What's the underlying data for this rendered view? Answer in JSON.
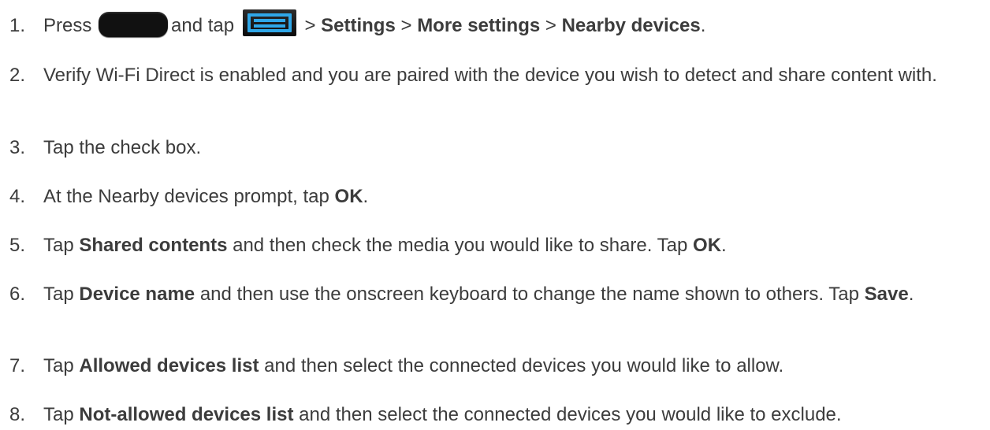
{
  "steps": [
    {
      "num": "1.",
      "parts": {
        "a": "Press",
        "b": "and tap",
        "c": ">",
        "settings": "Settings",
        "d": ">",
        "more": "More settings",
        "e": ">",
        "nearby": "Nearby devices",
        "f": "."
      },
      "icons": [
        "home-key-icon",
        "menu-key-icon"
      ]
    },
    {
      "num": "2.",
      "text": "Verify Wi-Fi Direct is enabled and you are paired with the device you wish to detect and share content with."
    },
    {
      "num": "3.",
      "text": "Tap the check box."
    },
    {
      "num": "4.",
      "parts": {
        "a": "At the Nearby devices prompt, tap",
        "ok": "OK",
        "b": "."
      }
    },
    {
      "num": "5.",
      "parts": {
        "a": "Tap",
        "shared": "Shared contents",
        "b": "and then check the media you would like to share. Tap",
        "ok": "OK",
        "c": "."
      }
    },
    {
      "num": "6.",
      "parts": {
        "a": "Tap",
        "device_name": "Device name",
        "b": "and then use the onscreen keyboard to change the name shown to others.",
        "c": "Tap",
        "save": "Save",
        "d": "."
      }
    },
    {
      "num": "7.",
      "parts": {
        "a": "Tap",
        "allowed": "Allowed devices list",
        "b": "and then select the connected devices you would like to allow."
      }
    },
    {
      "num": "8.",
      "parts": {
        "a": "Tap",
        "not_allowed": "Not-allowed devices list",
        "b": "and then select the connected devices you would like to exclude."
      }
    }
  ]
}
